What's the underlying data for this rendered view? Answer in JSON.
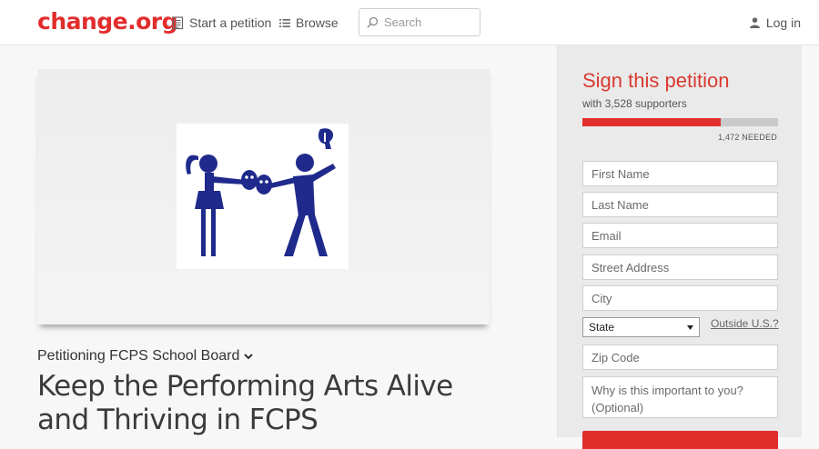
{
  "header": {
    "logo": "change.org",
    "nav": {
      "start_petition": "Start a petition",
      "browse": "Browse"
    },
    "search": {
      "placeholder": "Search",
      "value": ""
    },
    "login": "Log in"
  },
  "petition": {
    "target": "Petitioning FCPS School Board",
    "title": "Keep the Performing Arts Alive and Thriving in FCPS"
  },
  "sign_panel": {
    "heading": "Sign this petition",
    "supporters": "with 3,528 supporters",
    "progress_fraction": 0.706,
    "needed": "1,472 NEEDED",
    "fields": {
      "first_name": "First Name",
      "last_name": "Last Name",
      "email": "Email",
      "street": "Street Address",
      "city": "City",
      "state": "State",
      "outside_us": "Outside U.S.?",
      "zip": "Zip Code",
      "why": "Why is this important to you? (Optional)"
    }
  },
  "colors": {
    "brand_red": "#e22d2d",
    "heading_red": "#d93a30",
    "logo_figures": "#1f2a8c"
  },
  "icons": {
    "start_petition": "document-icon",
    "browse": "list-icon",
    "search": "search-icon",
    "login": "user-icon",
    "petitioning_toggle": "chevron-down-icon",
    "state_select": "caret-down-icon"
  }
}
